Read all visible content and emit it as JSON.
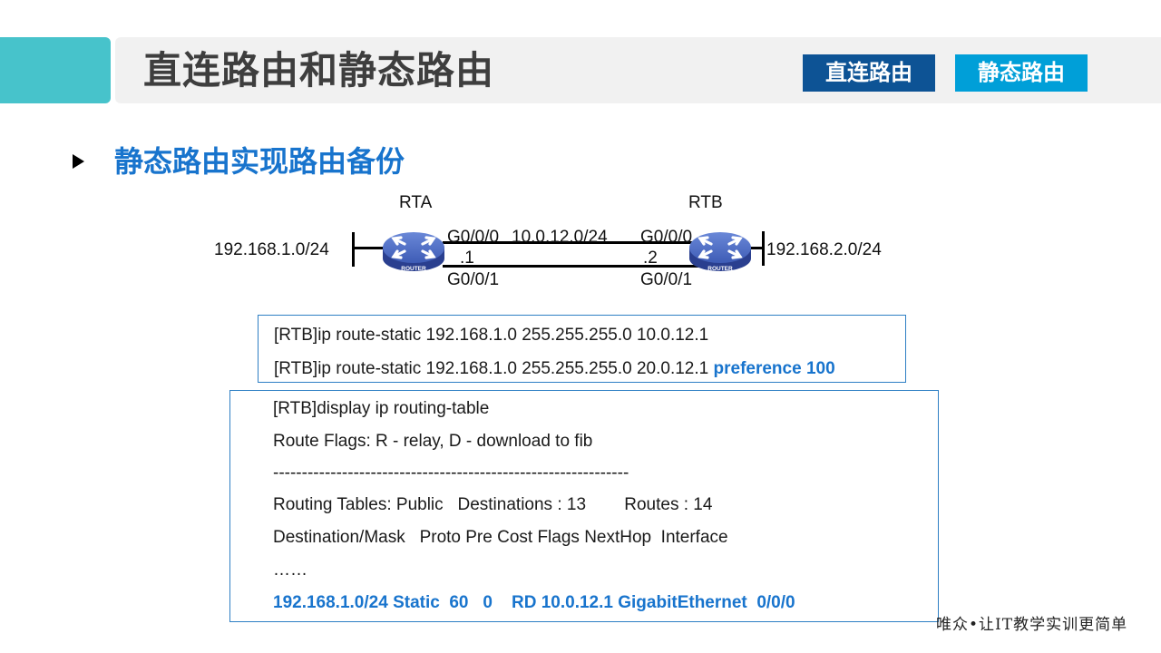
{
  "header": {
    "title": "直连路由和静态路由",
    "tabs": [
      {
        "label": "直连路由",
        "active": false
      },
      {
        "label": "静态路由",
        "active": true
      }
    ],
    "colors": {
      "accent": "#47c3cb",
      "bar": "#f1f1f1",
      "tab_direct": "#0d5395",
      "tab_static": "#009fd8"
    }
  },
  "section": {
    "title": "静态路由实现路由备份",
    "bullet_icon": "triangle-right-icon"
  },
  "topology": {
    "routers": [
      {
        "name": "RTA",
        "badge": "ROUTER"
      },
      {
        "name": "RTB",
        "badge": "ROUTER"
      }
    ],
    "lan_left": "192.168.1.0/24",
    "lan_right": "192.168.2.0/24",
    "link_top": {
      "left_iface": "G0/0/0",
      "network": "10.0.12.0/24",
      "right_iface": "G0/0/0"
    },
    "link_bottom": {
      "left_iface": "G0/0/1",
      "right_iface": "G0/0/1"
    },
    "left_host_id": ".1",
    "right_host_id": ".2"
  },
  "config_box": {
    "lines": [
      {
        "text": "[RTB]ip route-static 192.168.1.0 255.255.255.0 10.0.12.1",
        "highlight": ""
      },
      {
        "text": "[RTB]ip route-static 192.168.1.0 255.255.255.0 20.0.12.1 ",
        "highlight": "preference 100"
      }
    ]
  },
  "routing_table_box": {
    "command": "[RTB]display ip routing-table",
    "flags": "Route Flags: R - relay, D - download  to fib",
    "separator": "--------------------------------------------------------------",
    "summary": "Routing Tables: Public   Destinations : 13        Routes : 14",
    "columns": "Destination/Mask   Proto Pre Cost Flags NextHop  Interface",
    "ellipsis": "……",
    "highlight_row": "192.168.1.0/24 Static  60   0    RD 10.0.12.1 GigabitEthernet  0/0/0"
  },
  "footer": {
    "slogan": "唯众•让IT教学实训更简单"
  }
}
